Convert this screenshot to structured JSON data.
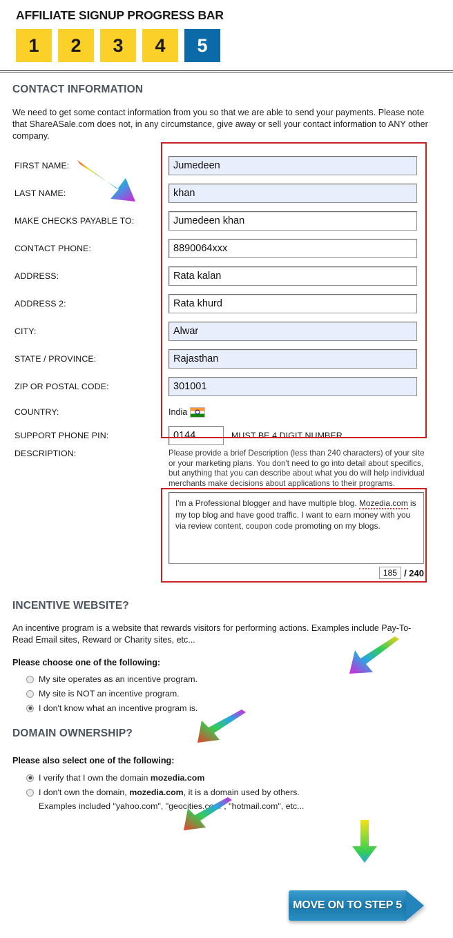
{
  "header": {
    "title": "AFFILIATE SIGNUP PROGRESS BAR",
    "steps": [
      {
        "label": "1",
        "state": "todo"
      },
      {
        "label": "2",
        "state": "todo"
      },
      {
        "label": "3",
        "state": "todo"
      },
      {
        "label": "4",
        "state": "todo"
      },
      {
        "label": "5",
        "state": "current"
      }
    ],
    "colors": {
      "step_todo_bg": "#fbd029",
      "step_current_bg": "#0d6aa8",
      "step_current_fg": "#ffffff"
    }
  },
  "contact": {
    "heading": "CONTACT INFORMATION",
    "intro": "We need to get some contact information from you so that we are able to send your payments. Please note that ShareASale.com does not, in any circumstance, give away or sell your contact information to ANY other company.",
    "fields": [
      {
        "label": "FIRST NAME:",
        "value": "Jumedeen",
        "style": "auto"
      },
      {
        "label": "LAST NAME:",
        "value": "khan",
        "style": "auto"
      },
      {
        "label": "MAKE CHECKS PAYABLE TO:",
        "value": "Jumedeen khan",
        "style": "plain"
      },
      {
        "label": "CONTACT PHONE:",
        "value": "8890064xxx",
        "style": "plain"
      },
      {
        "label": "ADDRESS:",
        "value": "Rata kalan",
        "style": "plain"
      },
      {
        "label": "ADDRESS 2:",
        "value": "Rata khurd",
        "style": "plain"
      },
      {
        "label": "CITY:",
        "value": "Alwar",
        "style": "auto"
      },
      {
        "label": "STATE / PROVINCE:",
        "value": "Rajasthan",
        "style": "plain"
      },
      {
        "label": "ZIP OR POSTAL CODE:",
        "value": "301001",
        "style": "auto"
      }
    ],
    "country": {
      "label": "COUNTRY:",
      "value": "India",
      "flag_icon": "india-flag-icon"
    },
    "pin": {
      "label": "SUPPORT PHONE PIN:",
      "value": "0144",
      "note": "MUST BE 4 DIGIT NUMBER"
    },
    "description": {
      "label": "DESCRIPTION:",
      "help": "Please provide a brief Description (less than 240 characters) of your site or your marketing plans. You don't need to go into detail about specifics, but anything that you can describe about what you do will help individual merchants make decisions about applications to their programs.",
      "value_part1": "I'm a Professional blogger and have multiple blog. ",
      "value_misspelled": "Mozedia.com",
      "value_part2": " is my top blog and have good traffic. I want to earn money with you via review content, coupon code promoting on my blogs.",
      "char_count": "185",
      "char_max": "/ 240"
    },
    "annotation_color": "#cc1f22"
  },
  "incentive": {
    "heading": "INCENTIVE WEBSITE?",
    "description": "An incentive program is a website that rewards visitors for performing actions. Examples include Pay-To-Read Email sites, Reward or Charity sites, etc...",
    "prompt": "Please choose one of the following:",
    "options": [
      {
        "label": "My site operates as an incentive program.",
        "selected": false
      },
      {
        "label": "My site is NOT an incentive program.",
        "selected": false
      },
      {
        "label": "I don't know what an incentive program is.",
        "selected": true
      }
    ]
  },
  "domain": {
    "heading": "DOMAIN OWNERSHIP?",
    "prompt": "Please also select one of the following:",
    "option1_pre": "I verify that I own the domain ",
    "option1_domain": "mozedia.com",
    "option1_selected": true,
    "option2_pre": "I don't own the domain, ",
    "option2_domain": "mozedia.com",
    "option2_post": ", it is a domain used by others.",
    "option2_selected": false,
    "examples": "Examples included \"yahoo.com\", \"geocities.com\", \"hotmail.com\", etc..."
  },
  "cta": {
    "label": "MOVE ON TO STEP 5",
    "color": "#1c7fb5"
  }
}
